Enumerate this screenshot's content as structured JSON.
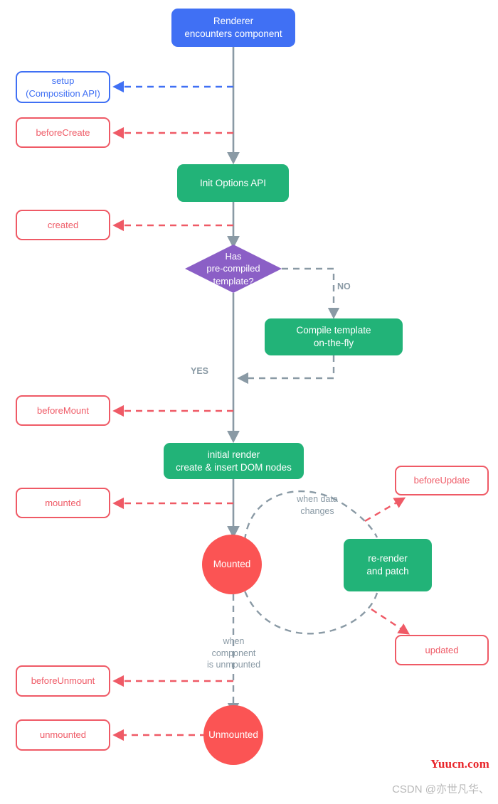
{
  "diagram": {
    "title": "Vue component lifecycle flowchart",
    "colors": {
      "blue": "#4070f4",
      "green": "#22b378",
      "red": "#fb5454",
      "hook_red": "#ef5a66",
      "purple": "#8b5fc6",
      "gray_line": "#8a9aa5"
    },
    "nodes": {
      "renderer": "Renderer\nencounters component",
      "setup": "setup\n(Composition API)",
      "before_create": "beforeCreate",
      "init_options": "Init Options API",
      "created": "created",
      "has_template": "Has\npre-compiled\ntemplate?",
      "compile_template": "Compile template\non-the-fly",
      "before_mount": "beforeMount",
      "initial_render": "initial render\ncreate & insert DOM nodes",
      "mounted_hook": "mounted",
      "mounted_state": "Mounted",
      "before_update": "beforeUpdate",
      "re_render": "re-render\nand patch",
      "updated": "updated",
      "before_unmount": "beforeUnmount",
      "unmounted_state": "Unmounted",
      "unmounted_hook": "unmounted"
    },
    "edge_labels": {
      "no": "NO",
      "yes": "YES",
      "when_data_changes": "when data\nchanges",
      "when_unmounted": "when\ncomponent\nis unmounted"
    }
  },
  "watermarks": {
    "site": "Yuucn.com",
    "author": "CSDN @亦世凡华、"
  }
}
